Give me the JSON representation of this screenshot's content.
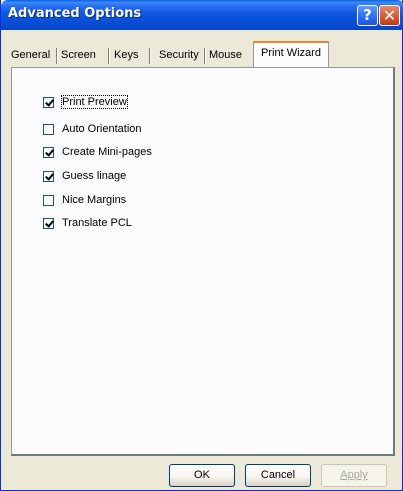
{
  "window": {
    "title": "Advanced Options",
    "help_glyph": "?",
    "close_glyph": "✕"
  },
  "tabs": [
    {
      "label": "General"
    },
    {
      "label": "Screen"
    },
    {
      "label": "Keys"
    },
    {
      "label": "Security"
    },
    {
      "label": "Mouse"
    },
    {
      "label": "Print Wizard",
      "active": true
    }
  ],
  "options": [
    {
      "label": "Print Preview",
      "checked": true
    },
    {
      "label": "Auto Orientation",
      "checked": false
    },
    {
      "label": "Create Mini-pages",
      "checked": true
    },
    {
      "label": "Guess linage",
      "checked": true
    },
    {
      "label": "Nice Margins",
      "checked": false
    },
    {
      "label": "Translate PCL",
      "checked": true
    }
  ],
  "buttons": {
    "ok": "OK",
    "cancel": "Cancel",
    "apply": "Apply"
  },
  "colors": {
    "titlebar": "#0a55e0",
    "active_tab_accent": "#e68b2c",
    "dialog_bg": "#ece9d8"
  }
}
